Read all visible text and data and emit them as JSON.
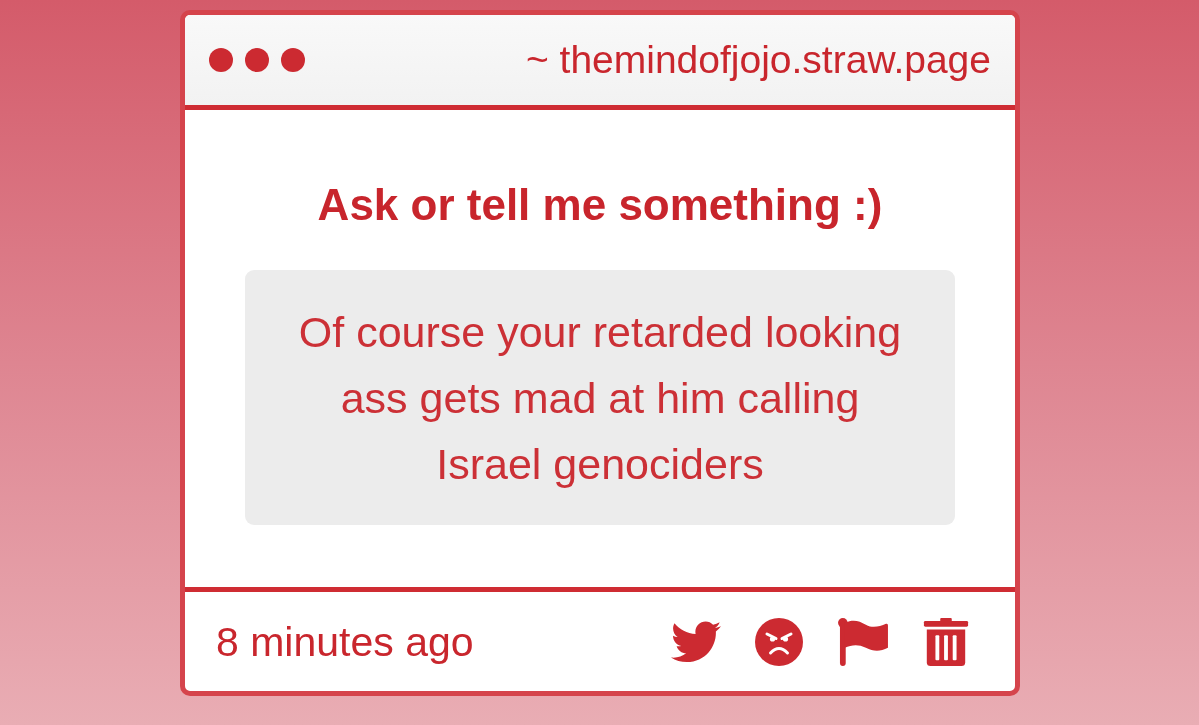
{
  "window": {
    "address": "~ themindofjojo.straw.page"
  },
  "prompt": "Ask or tell me something :)",
  "message": "Of course your retarded looking ass gets mad at him calling Israel genociders",
  "footer": {
    "time": "8 minutes ago",
    "actions": [
      {
        "kind": "share"
      },
      {
        "kind": "react"
      },
      {
        "kind": "report"
      },
      {
        "kind": "delete"
      }
    ]
  }
}
